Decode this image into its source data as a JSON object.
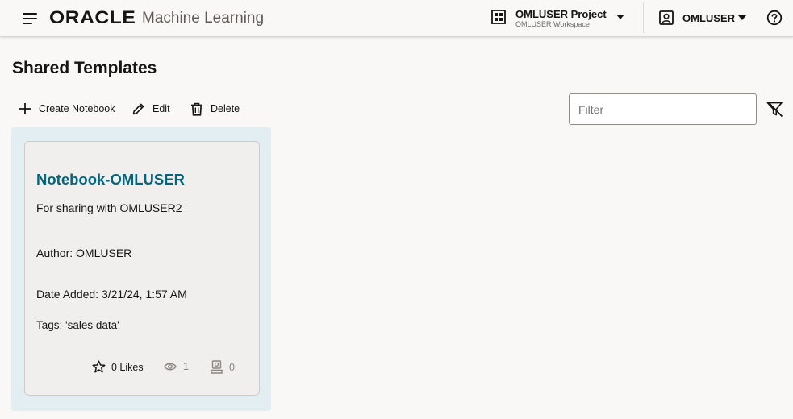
{
  "header": {
    "logo_text": "ORACLE",
    "product_name": "Machine Learning",
    "project_name": "OMLUSER Project",
    "workspace_name": "OMLUSER Workspace",
    "user_name": "OMLUSER"
  },
  "page": {
    "title": "Shared Templates"
  },
  "toolbar": {
    "create_label": "Create Notebook",
    "edit_label": "Edit",
    "delete_label": "Delete"
  },
  "filter": {
    "placeholder": "Filter",
    "value": ""
  },
  "card": {
    "title": "Notebook-OMLUSER",
    "description": "For sharing with OMLUSER2",
    "author": "Author: OMLUSER",
    "date_added": "Date Added: 3/21/24, 1:57 AM",
    "tags": "Tags: 'sales data'",
    "likes": "0 Likes",
    "views": "1",
    "copies": "0"
  },
  "colors": {
    "accent_title": "#04657f",
    "card_highlight": "#e3eef3",
    "background": "#f9f8f6"
  },
  "icons": {
    "menu": "hamburger-icon",
    "project": "grid-icon",
    "user": "user-badge-icon",
    "help": "help-circle-icon",
    "create": "plus-icon",
    "edit": "pencil-icon",
    "delete": "trash-icon",
    "clear_filter": "filter-clear-icon",
    "likes": "star-icon",
    "views": "eye-icon",
    "copies": "copy-user-icon"
  }
}
